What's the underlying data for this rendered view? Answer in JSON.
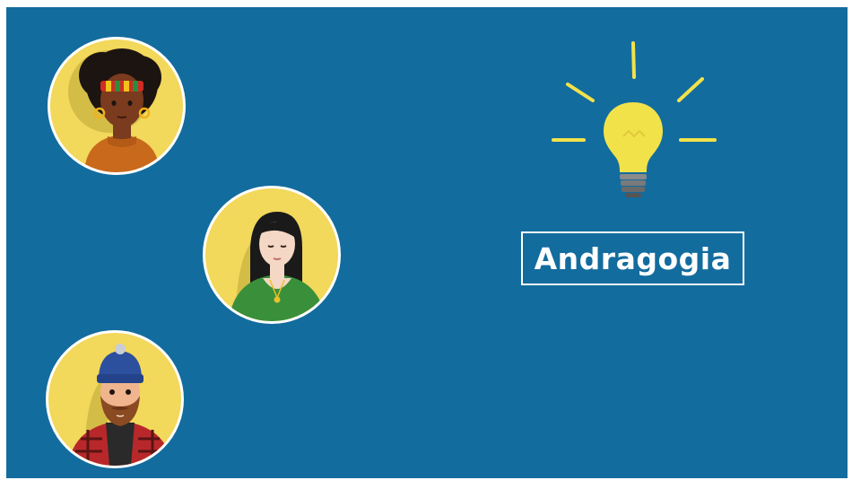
{
  "title": "Andragogia",
  "colors": {
    "background": "#136c9e",
    "avatar_bg": "#f2d85b",
    "bulb": "#f2e24a",
    "text": "#ffffff"
  },
  "icons": [
    "woman-afro-avatar-icon",
    "woman-green-sweater-avatar-icon",
    "man-beanie-avatar-icon",
    "lightbulb-icon"
  ]
}
